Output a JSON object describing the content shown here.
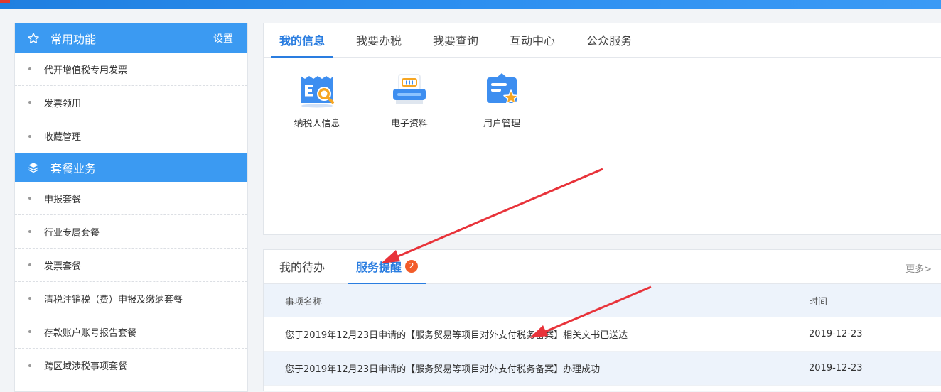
{
  "sidebar": {
    "section1": {
      "title": "常用功能",
      "settings": "设置",
      "icon": "star-icon"
    },
    "section1_items": [
      {
        "label": "代开增值税专用发票"
      },
      {
        "label": "发票领用"
      },
      {
        "label": "收藏管理"
      }
    ],
    "section2": {
      "title": "套餐业务",
      "icon": "layers-icon"
    },
    "section2_items": [
      {
        "label": "申报套餐"
      },
      {
        "label": "行业专属套餐"
      },
      {
        "label": "发票套餐"
      },
      {
        "label": "清税注销税（费）申报及缴纳套餐"
      },
      {
        "label": "存款账户账号报告套餐"
      },
      {
        "label": "跨区域涉税事项套餐"
      }
    ]
  },
  "main_tabs": [
    {
      "label": "我的信息"
    },
    {
      "label": "我要办税"
    },
    {
      "label": "我要查询"
    },
    {
      "label": "互动中心"
    },
    {
      "label": "公众服务"
    }
  ],
  "apps": [
    {
      "label": "纳税人信息",
      "icon": "taxpayer-info-icon"
    },
    {
      "label": "电子资料",
      "icon": "electronic-data-icon"
    },
    {
      "label": "用户管理",
      "icon": "user-management-icon"
    }
  ],
  "bottom": {
    "tabs": [
      {
        "label": "我的待办"
      },
      {
        "label": "服务提醒"
      }
    ],
    "badge": "2",
    "more": "更多>",
    "columns": {
      "name": "事项名称",
      "time": "时间"
    },
    "rows": [
      {
        "name": "您于2019年12月23日申请的【服务贸易等项目对外支付税务备案】相关文书已送达",
        "time": "2019-12-23"
      },
      {
        "name": "您于2019年12月23日申请的【服务贸易等项目对外支付税务备案】办理成功",
        "time": "2019-12-23"
      }
    ]
  },
  "colors": {
    "accent": "#2a7de0",
    "sidebar_header": "#3b9af2",
    "badge": "#f25c2a",
    "arrow": "#e8333a"
  }
}
